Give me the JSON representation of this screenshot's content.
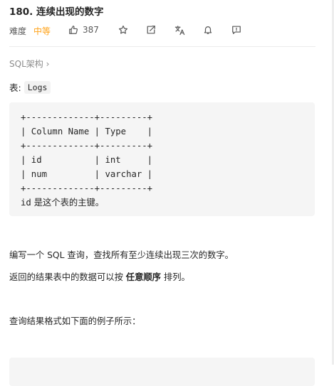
{
  "problem": {
    "title": "180. 连续出现的数字",
    "difficulty_label": "难度",
    "difficulty": "中等",
    "likes": "387"
  },
  "toolbar_icons": [
    "thumbs-up-icon",
    "star-icon",
    "share-icon",
    "translate-icon",
    "bell-icon",
    "comment-icon"
  ],
  "colors": {
    "difficulty": "#ffa116",
    "code_bg": "#f5f5f5",
    "muted": "#8c8c8c"
  },
  "breadcrumb": {
    "label": "SQL架构",
    "chevron": "›"
  },
  "table_intro": {
    "label": "表:",
    "name": "Logs"
  },
  "schema": {
    "lines": [
      "+-------------+---------+",
      "| Column Name | Type    |",
      "+-------------+---------+",
      "| id          | int     |",
      "| num         | varchar |",
      "+-------------+---------+"
    ],
    "pk_code": "id",
    "pk_text": " 是这个表的主键。"
  },
  "description": {
    "p1": "编写一个 SQL 查询，查找所有至少连续出现三次的数字。",
    "p2_prefix": "返回的结果表中的数据可以按 ",
    "p2_bold": "任意顺序",
    "p2_suffix": " 排列。",
    "p3": "查询结果格式如下面的例子所示："
  }
}
